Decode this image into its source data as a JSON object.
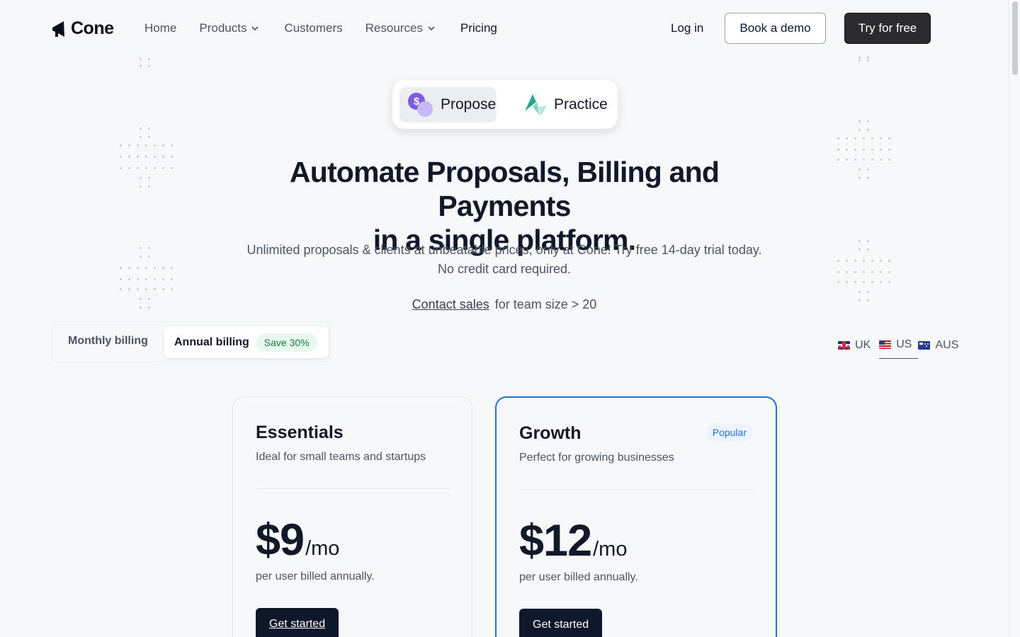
{
  "nav": {
    "brand": "Cone",
    "links": [
      {
        "label": "Home",
        "has_dropdown": false
      },
      {
        "label": "Products",
        "has_dropdown": true
      },
      {
        "label": "Customers",
        "has_dropdown": false
      },
      {
        "label": "Resources",
        "has_dropdown": true
      },
      {
        "label": "Pricing",
        "has_dropdown": false
      }
    ],
    "login": "Log in",
    "demo_button": "Book a demo",
    "try_button": "Try for free"
  },
  "product_switch": {
    "items": [
      {
        "label": "Propose",
        "icon": "propose-icon",
        "active": true
      },
      {
        "label": "Practice",
        "icon": "practice-icon",
        "active": false
      }
    ]
  },
  "hero": {
    "title_line1": "Automate Proposals, Billing and Payments",
    "title_line2": "in a single platform.",
    "subtitle": "Unlimited proposals & clients at unbeatable prices, only at Cone! Try free 14-day trial today. No credit card required.",
    "contact_link": "Contact sales",
    "contact_text": "for team size > 20"
  },
  "billing": {
    "monthly_label": "Monthly billing",
    "annual_label": "Annual billing",
    "save_badge": "Save 30%",
    "selected": "annual"
  },
  "regions": [
    {
      "label": "UK",
      "flag": "uk-flag",
      "active": false
    },
    {
      "label": "US",
      "flag": "us-flag",
      "active": true
    },
    {
      "label": "AUS",
      "flag": "aus-flag",
      "active": false
    }
  ],
  "plans": [
    {
      "name": "Essentials",
      "description": "Ideal for small teams and startups",
      "price": "$9",
      "period": "/mo",
      "note": "per user billed annually.",
      "cta": "Get started",
      "badge": ""
    },
    {
      "name": "Growth",
      "description": "Perfect for growing businesses",
      "price": "$12",
      "period": "/mo",
      "note": "per user billed annually.",
      "cta": "Get started",
      "badge": "Popular"
    }
  ],
  "colors": {
    "background": "#f6f8fa",
    "primary_dark": "#0f172a",
    "accent_blue": "#1d72d8",
    "save_green": "#15803d",
    "propose_purple": "#7c5ce0",
    "practice_teal": "#38b2a0"
  }
}
